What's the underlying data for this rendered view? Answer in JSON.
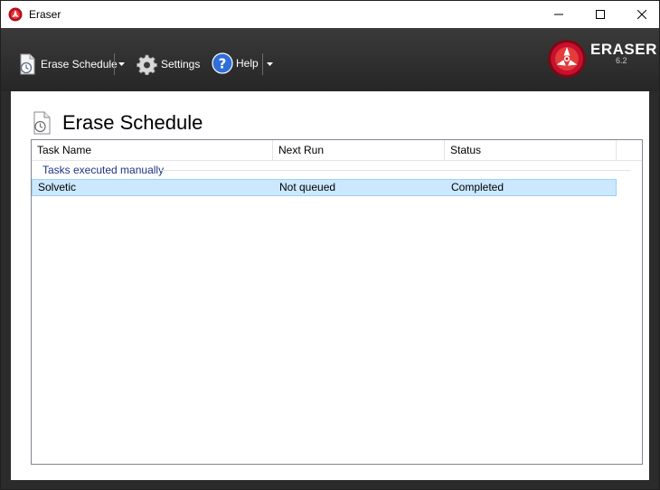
{
  "window": {
    "title": "Eraser"
  },
  "toolbar": {
    "erase_schedule_label": "Erase Schedule",
    "settings_label": "Settings",
    "help_label": "Help"
  },
  "logo": {
    "name": "ERASER",
    "version": "6.2"
  },
  "page": {
    "title": "Erase Schedule"
  },
  "table": {
    "columns": [
      "Task Name",
      "Next Run",
      "Status"
    ],
    "groups": [
      {
        "label": "Tasks executed manually",
        "rows": [
          {
            "task_name": "Solvetic",
            "next_run": "Not queued",
            "status": "Completed"
          }
        ]
      }
    ]
  },
  "colors": {
    "toolbar_bg": "#2b2b2b",
    "selection_bg": "#cce8ff",
    "group_text": "#1e3287",
    "logo_red": "#c8102e"
  },
  "icons": {
    "app": "eraser-app-icon",
    "erase_schedule": "schedule-document-icon",
    "settings": "gear-icon",
    "help": "question-circle-icon"
  }
}
